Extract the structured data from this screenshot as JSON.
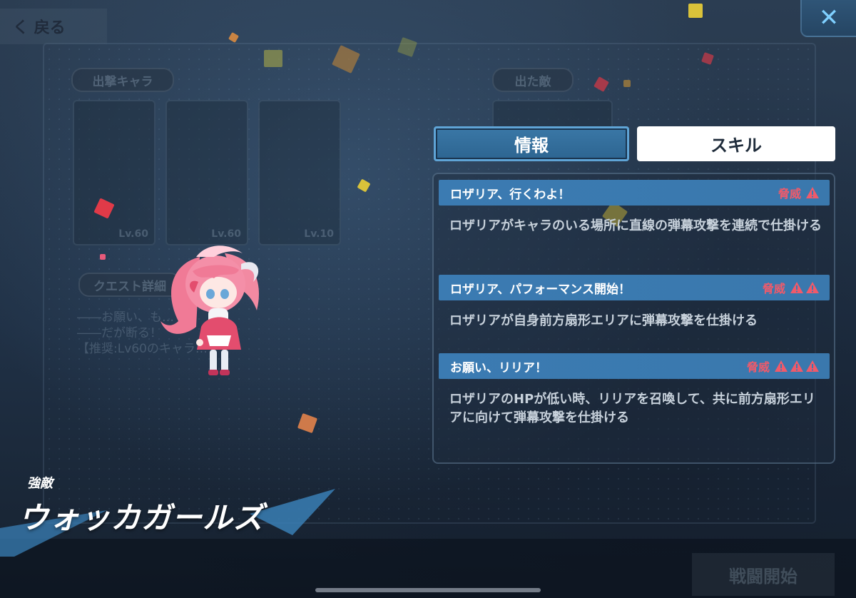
{
  "nav": {
    "back_label": "く 戻る",
    "close_glyph": "✕"
  },
  "background": {
    "sortie_label": "出撃キャラ",
    "enemy_label": "出た敵",
    "quest_label": "クエスト詳細",
    "card_levels": [
      "Lv.60",
      "Lv.60",
      "Lv.10"
    ],
    "quest_lines": [
      "――お願い、も…",
      "――だが断る！",
      "【推奨:Lv60のキャラ…"
    ],
    "start_label": "戦闘開始"
  },
  "tabs": [
    {
      "label": "情報",
      "active": true
    },
    {
      "label": "スキル",
      "active": false
    }
  ],
  "threat_label": "脅威",
  "skills": [
    {
      "name": "ロザリア、行くわよ！",
      "threat_level": 1,
      "description": "ロザリアがキャラのいる場所に直線の弾幕攻撃を連続で仕掛ける"
    },
    {
      "name": "ロザリア、パフォーマンス開始！",
      "threat_level": 2,
      "description": "ロザリアが自身前方扇形エリアに弾幕攻撃を仕掛ける"
    },
    {
      "name": "お願い、リリア！",
      "threat_level": 3,
      "description": "ロザリアのHPが低い時、リリアを召喚して、共に前方扇形エリアに向けて弾幕攻撃を仕掛ける"
    }
  ],
  "boss": {
    "subtitle": "強敵",
    "name": "ウォッカガールズ"
  },
  "colors": {
    "accent_blue": "#3b7bb2",
    "threat_red": "#f05a6a",
    "close_icon": "#7fd0ff"
  }
}
